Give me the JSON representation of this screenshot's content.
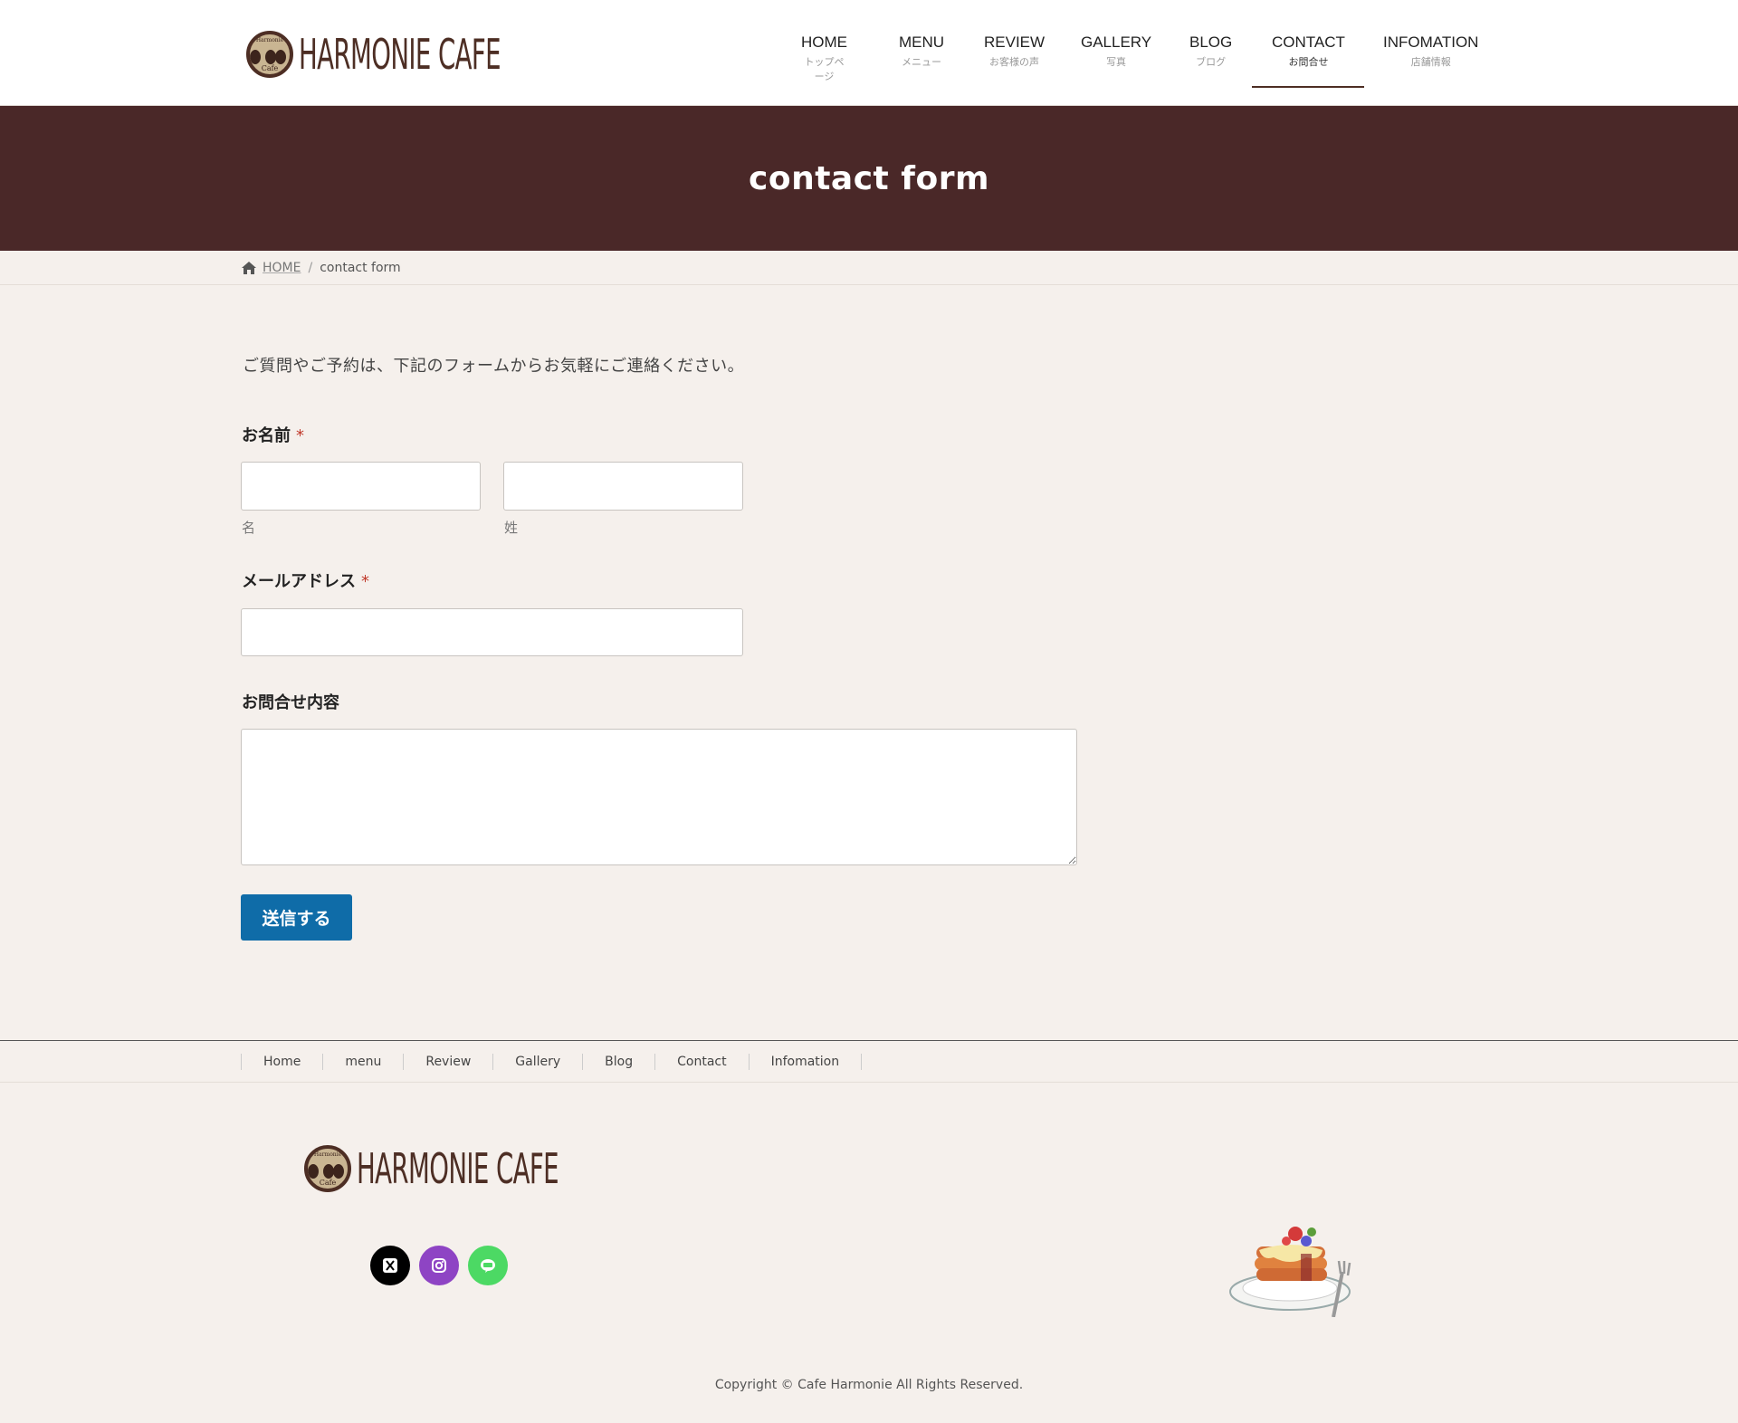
{
  "header": {
    "logo_text": "HARMONIE CAFE",
    "logo_badge_top": "Harmonie",
    "logo_badge_bottom": "Cafe",
    "nav": [
      {
        "en": "HOME",
        "jp": "トップページ"
      },
      {
        "en": "MENU",
        "jp": "メニュー"
      },
      {
        "en": "REVIEW",
        "jp": "お客様の声"
      },
      {
        "en": "GALLERY",
        "jp": "写真"
      },
      {
        "en": "BLOG",
        "jp": "ブログ"
      },
      {
        "en": "CONTACT",
        "jp": "お問合せ"
      },
      {
        "en": "INFOMATION",
        "jp": "店舗情報"
      }
    ],
    "active_nav": "CONTACT"
  },
  "banner": {
    "title": "contact form"
  },
  "breadcrumb": {
    "home": "HOME",
    "separator": "/",
    "current": "contact form"
  },
  "form": {
    "intro": "ご質問やご予約は、下記のフォームからお気軽にご連絡ください。",
    "name_label": "お名前",
    "required_mark": "*",
    "first_name_sub": "名",
    "last_name_sub": "姓",
    "first_name_value": "",
    "last_name_value": "",
    "email_label": "メールアドレス",
    "email_value": "",
    "message_label": "お問合せ内容",
    "message_value": "",
    "submit_label": "送信する"
  },
  "footer": {
    "nav": [
      "Home",
      "menu",
      "Review",
      "Gallery",
      "Blog",
      "Contact",
      "Infomation"
    ],
    "logo_text": "HARMONIE CAFE",
    "social": [
      {
        "icon": "x-icon",
        "color": "#000000"
      },
      {
        "icon": "instagram-icon",
        "color": "#8e44c4"
      },
      {
        "icon": "line-icon",
        "color": "#4cd964"
      }
    ],
    "copyright": "Copyright © Cafe Harmonie All Rights Reserved."
  },
  "colors": {
    "brand_brown": "#4a2828",
    "accent_blue": "#0f6ca8",
    "background": "#f5f0ec",
    "required_red": "#c0392b"
  }
}
